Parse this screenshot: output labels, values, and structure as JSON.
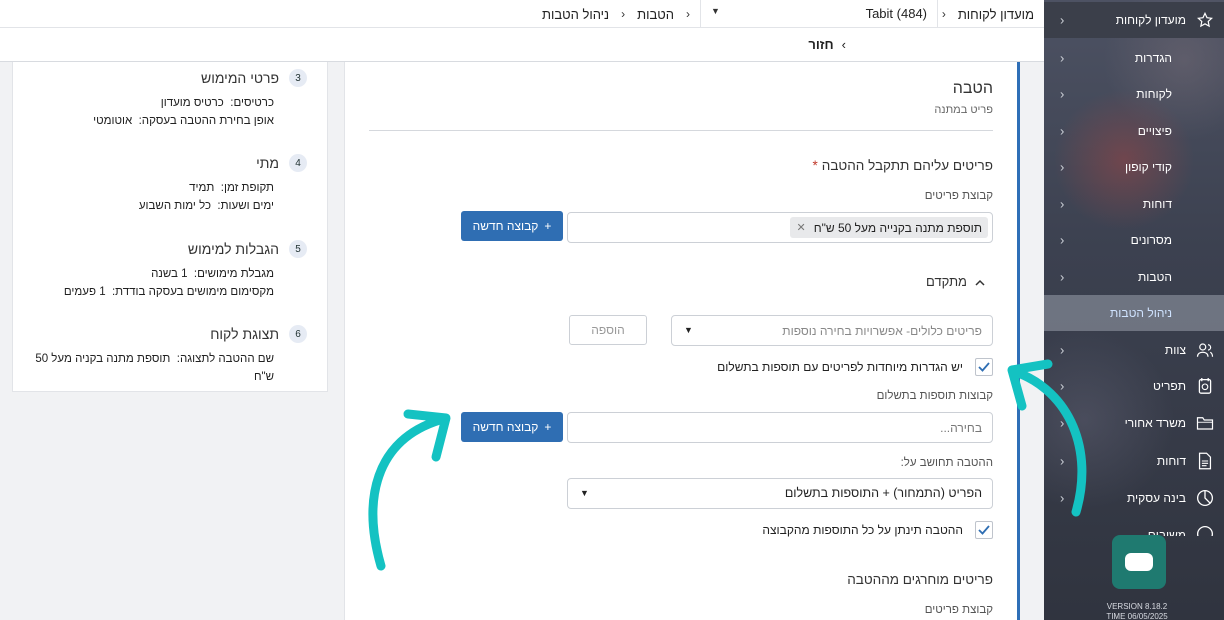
{
  "sidebar": {
    "header_label": "מועדון לקוחות",
    "items": [
      {
        "label": "הגדרות"
      },
      {
        "label": "לקוחות"
      },
      {
        "label": "פיצויים"
      },
      {
        "label": "קודי קופון"
      },
      {
        "label": "דוחות"
      },
      {
        "label": "מסרונים"
      },
      {
        "label": "הטבות"
      },
      {
        "label": "ניהול הטבות"
      }
    ],
    "main_items": [
      {
        "label": "צוות"
      },
      {
        "label": "תפריט"
      },
      {
        "label": "משרד אחורי"
      },
      {
        "label": "דוחות"
      },
      {
        "label": "בינה עסקית"
      },
      {
        "label": "משובים"
      }
    ],
    "version": "VERSION 8.18.2",
    "time": "TIME 06/05/2025"
  },
  "topbar": {
    "breadcrumb": [
      "מועדון לקוחות",
      "הטבות",
      "ניהול הטבות"
    ],
    "venue": "Tabit (484)"
  },
  "backbar": {
    "label": "חזור"
  },
  "summary": {
    "sections": [
      {
        "num": "3",
        "title": "פרטי המימוש",
        "lines": [
          {
            "key": "כרטיסים:",
            "val": "כרטיס מועדון"
          },
          {
            "key": "אופן בחירת ההטבה בעסקה:",
            "val": "אוטומטי"
          }
        ]
      },
      {
        "num": "4",
        "title": "מתי",
        "lines": [
          {
            "key": "תקופת זמן:",
            "val": "תמיד"
          },
          {
            "key": "ימים ושעות:",
            "val": "כל ימות השבוע"
          }
        ]
      },
      {
        "num": "5",
        "title": "הגבלות למימוש",
        "lines": [
          {
            "key": "מגבלת מימושים:",
            "val": "1 בשנה"
          },
          {
            "key": "מקסימום מימושים בעסקה בודדת:",
            "val": "1 פעמים"
          }
        ]
      },
      {
        "num": "6",
        "title": "תצוגת לקוח",
        "lines": [
          {
            "key": "שם ההטבה לתצוגה:",
            "val": "תוספת מתנה בקניה מעל 50 ש\"ח"
          }
        ]
      }
    ]
  },
  "form": {
    "title": "הטבה",
    "subtitle": "פריט במתנה",
    "items_section": "פריטים עליהם תתקבל ההטבה",
    "required_mark": "*",
    "items_group_label": "קבוצת פריטים",
    "items_group_tag": "תוספת מתנה בקנייה מעל 50 ש\"ח",
    "new_group_btn": "קבוצה חדשה",
    "plus": "+",
    "advanced": "מתקדם",
    "more_options_placeholder": "פריטים כלולים- אפשרויות בחירה נוספות",
    "add_btn": "הוספה",
    "special_settings_label": "יש הגדרות מיוחדות לפריטים עם תוספות בתשלום",
    "paid_addons_label": "קבוצות תוספות בתשלום",
    "paid_addons_placeholder": "בחירה...",
    "calc_label": "ההטבה תחושב על:",
    "calc_value": "הפריט (התמחור) + התוספות בתשלום",
    "all_addons_label": "ההטבה תינתן על כל התוספות מהקבוצה",
    "excluded_section": "פריטים מוחרגים מההטבה",
    "excluded_group_label": "קבוצת פריטים"
  },
  "colors": {
    "primary": "#2f6eb3",
    "annotation_arrow": "#14c2c2",
    "sidebar_bg": "#3a3f4d",
    "chat": "#1f7a70"
  }
}
